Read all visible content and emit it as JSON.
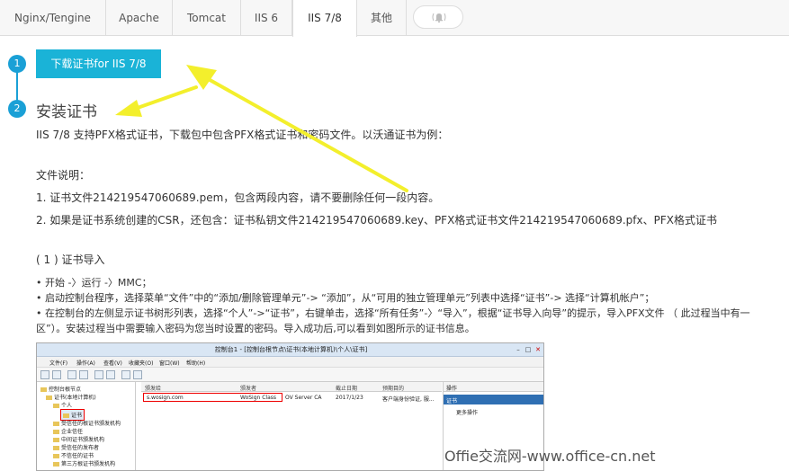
{
  "tabs": [
    {
      "label": "Nginx/Tengine",
      "active": false
    },
    {
      "label": "Apache",
      "active": false
    },
    {
      "label": "Tomcat",
      "active": false
    },
    {
      "label": "IIS 6",
      "active": false
    },
    {
      "label": "IIS 7/8",
      "active": true
    },
    {
      "label": "其他",
      "active": false
    }
  ],
  "tab_icon": "bell-icon",
  "steps": [
    "1",
    "2"
  ],
  "download_button": "下载证书for IIS 7/8",
  "install_title": "安装证书",
  "intro": "IIS 7/8 支持PFX格式证书，下载包中包含PFX格式证书和密码文件。以沃通证书为例：",
  "files_title": "文件说明：",
  "file_1": "1. 证书文件214219547060689.pem，包含两段内容，请不要删除任何一段内容。",
  "file_2": "2. 如果是证书系统创建的CSR，还包含：证书私钥文件214219547060689.key、PFX格式证书文件214219547060689.pfx、PFX格式证书",
  "import_title": "( 1 ) 证书导入",
  "bullet_1": "• 开始 -〉运行 -〉MMC；",
  "bullet_2": "• 启动控制台程序，选择菜单“文件”中的“添加/删除管理单元”-> “添加”，从“可用的独立管理单元”列表中选择“证书”-> 选择“计算机帐户”；",
  "bullet_3": "• 在控制台的左侧显示证书树形列表，选择“个人”->“证书”，右键单击，选择“所有任务”-〉“导入”，根据“证书导入向导”的提示，导入PFX文件 （ 此过程当中有一",
  "bullet_3b": "区”）。安装过程当中需要输入密码为您当时设置的密码。导入成功后,可以看到如图所示的证书信息。",
  "screenshot": {
    "title": "控制台1 - [控制台根节点\\证书(本地计算机)\\个人\\证书]",
    "menu": [
      "文件(F)",
      "操作(A)",
      "查看(V)",
      "收藏夹(O)",
      "窗口(W)",
      "帮助(H)"
    ],
    "tree": [
      "控制台根节点",
      "证书(本地计算机)",
      "个人",
      "证书",
      "受信任的根证书颁发机构",
      "企业信任",
      "中间证书颁发机构",
      "受信任的发布者",
      "不信任的证书",
      "第三方根证书颁发机构"
    ],
    "columns": [
      "颁发给",
      "颁发者",
      "截止日期",
      "预期目的"
    ],
    "row": [
      "s.wosign.com",
      "WoSign Class",
      "OV Server CA",
      "2017/1/23",
      "客户端身份验证, 服..."
    ],
    "actions_head": "操作",
    "actions_selected": "证书",
    "actions_more": "更多操作"
  },
  "watermark": "Offie交流网-www.office-cn.net"
}
